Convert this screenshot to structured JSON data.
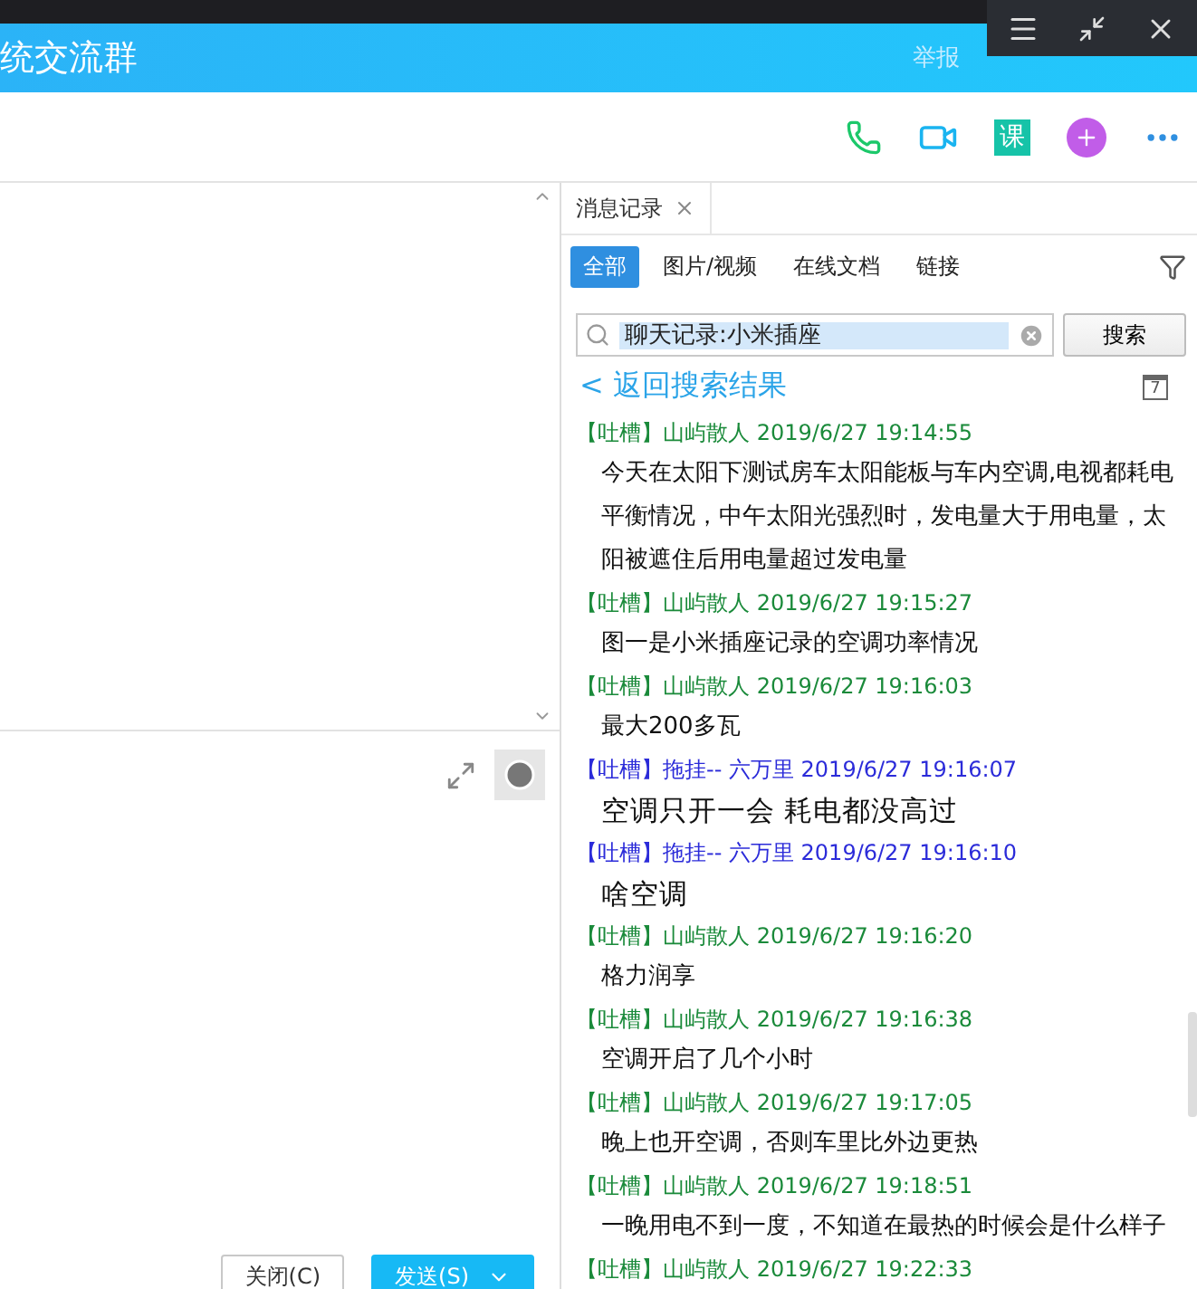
{
  "window": {
    "title": "统交流群",
    "report": "举报"
  },
  "toolbar": {
    "course_label": "课"
  },
  "history": {
    "tab": "消息记录",
    "filters": [
      {
        "label": "全部",
        "selected": true
      },
      {
        "label": "图片/视频",
        "selected": false
      },
      {
        "label": "在线文档",
        "selected": false
      },
      {
        "label": "链接",
        "selected": false
      }
    ],
    "search": {
      "value": "聊天记录:小米插座",
      "button": "搜索"
    },
    "back_link": "< 返回搜索结果",
    "calendar_day": "7",
    "messages": [
      {
        "header": "【吐槽】山屿散人 2019/6/27 19:14:55",
        "color": "#1a8a3a",
        "kind": "normal",
        "text": "今天在太阳下测试房车太阳能板与车内空调,电视都耗电平衡情况，中午太阳光强烈时，发电量大于用电量，太阳被遮住后用电量超过发电量"
      },
      {
        "header": "【吐槽】山屿散人 2019/6/27 19:15:27",
        "color": "#1a8a3a",
        "kind": "normal",
        "text": "图一是小米插座记录的空调功率情况"
      },
      {
        "header": "【吐槽】山屿散人 2019/6/27 19:16:03",
        "color": "#1a8a3a",
        "kind": "normal",
        "text": "最大200多瓦"
      },
      {
        "header": "【吐槽】拖挂--  六万里 2019/6/27 19:16:07",
        "color": "#2b2bd9",
        "kind": "large",
        "text": "空调只开一会  耗电都没高过"
      },
      {
        "header": "【吐槽】拖挂--  六万里 2019/6/27 19:16:10",
        "color": "#2b2bd9",
        "kind": "large",
        "text": "啥空调"
      },
      {
        "header": "【吐槽】山屿散人 2019/6/27 19:16:20",
        "color": "#1a8a3a",
        "kind": "normal",
        "text": "格力润享"
      },
      {
        "header": "【吐槽】山屿散人 2019/6/27 19:16:38",
        "color": "#1a8a3a",
        "kind": "normal",
        "text": "空调开启了几个小时"
      },
      {
        "header": "【吐槽】山屿散人 2019/6/27 19:17:05",
        "color": "#1a8a3a",
        "kind": "normal",
        "text": "晚上也开空调，否则车里比外边更热"
      },
      {
        "header": "【吐槽】山屿散人 2019/6/27 19:18:51",
        "color": "#1a8a3a",
        "kind": "normal",
        "text": "一晚用电不到一度，不知道在最热的时候会是什么样子"
      },
      {
        "header": "【吐槽】山屿散人 2019/6/27 19:22:33",
        "color": "#1a8a3a"
      }
    ]
  },
  "composer": {
    "buttons": [
      {
        "label": "关闭(C)",
        "kind": "plain"
      },
      {
        "label": "发送(S)",
        "kind": "primary"
      }
    ]
  }
}
